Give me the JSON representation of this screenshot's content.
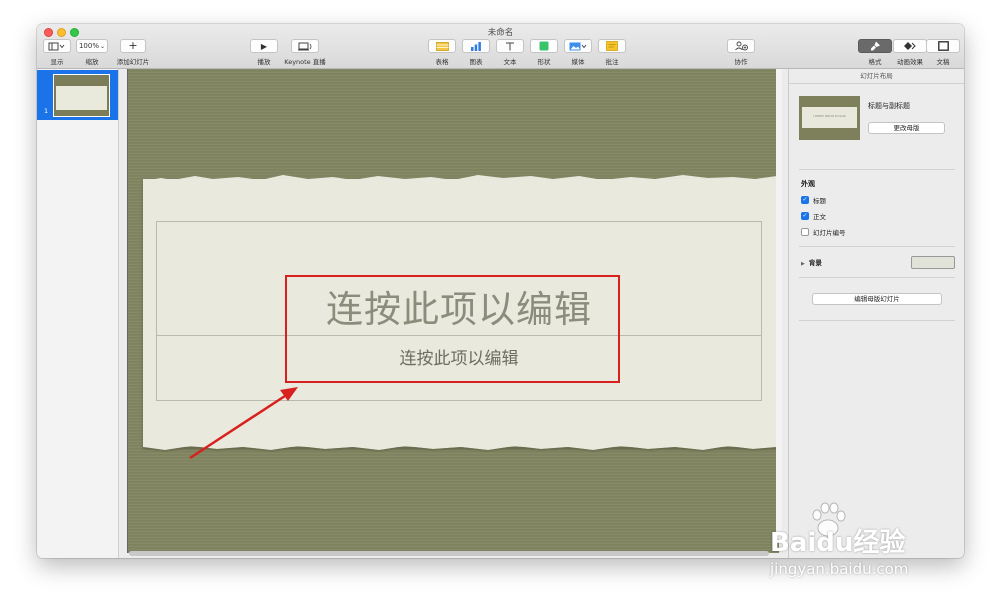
{
  "window": {
    "title": "未命名"
  },
  "toolbar": {
    "view_label": "显示",
    "zoom_value": "100%",
    "zoom_label": "缩放",
    "add_slide_label": "添加幻灯片",
    "play_label": "播放",
    "keynote_live_label": "Keynote 直播",
    "table_label": "表格",
    "chart_label": "图表",
    "text_label": "文本",
    "shape_label": "形状",
    "media_label": "媒体",
    "comment_label": "批注",
    "collaborate_label": "协作",
    "format_label": "格式",
    "animate_label": "动画效果",
    "document_label": "文稿"
  },
  "sidebar": {
    "slides": [
      {
        "number": "1"
      }
    ]
  },
  "slide": {
    "title_placeholder": "连按此项以编辑",
    "subtitle_placeholder": "连按此项以编辑",
    "highlight_color": "#d8201f"
  },
  "inspector": {
    "header": "幻灯片布局",
    "master_name": "标题与副标题",
    "change_master_button": "更改母版",
    "appearance_title": "外观",
    "checkboxes": [
      {
        "label": "标题",
        "checked": true
      },
      {
        "label": "正文",
        "checked": true
      },
      {
        "label": "幻灯片编号",
        "checked": false
      }
    ],
    "background_label": "背景",
    "edit_master_button": "编辑母版幻灯片"
  },
  "watermark": {
    "brand": "Baidu经验",
    "url": "jingyan.baidu.com"
  }
}
